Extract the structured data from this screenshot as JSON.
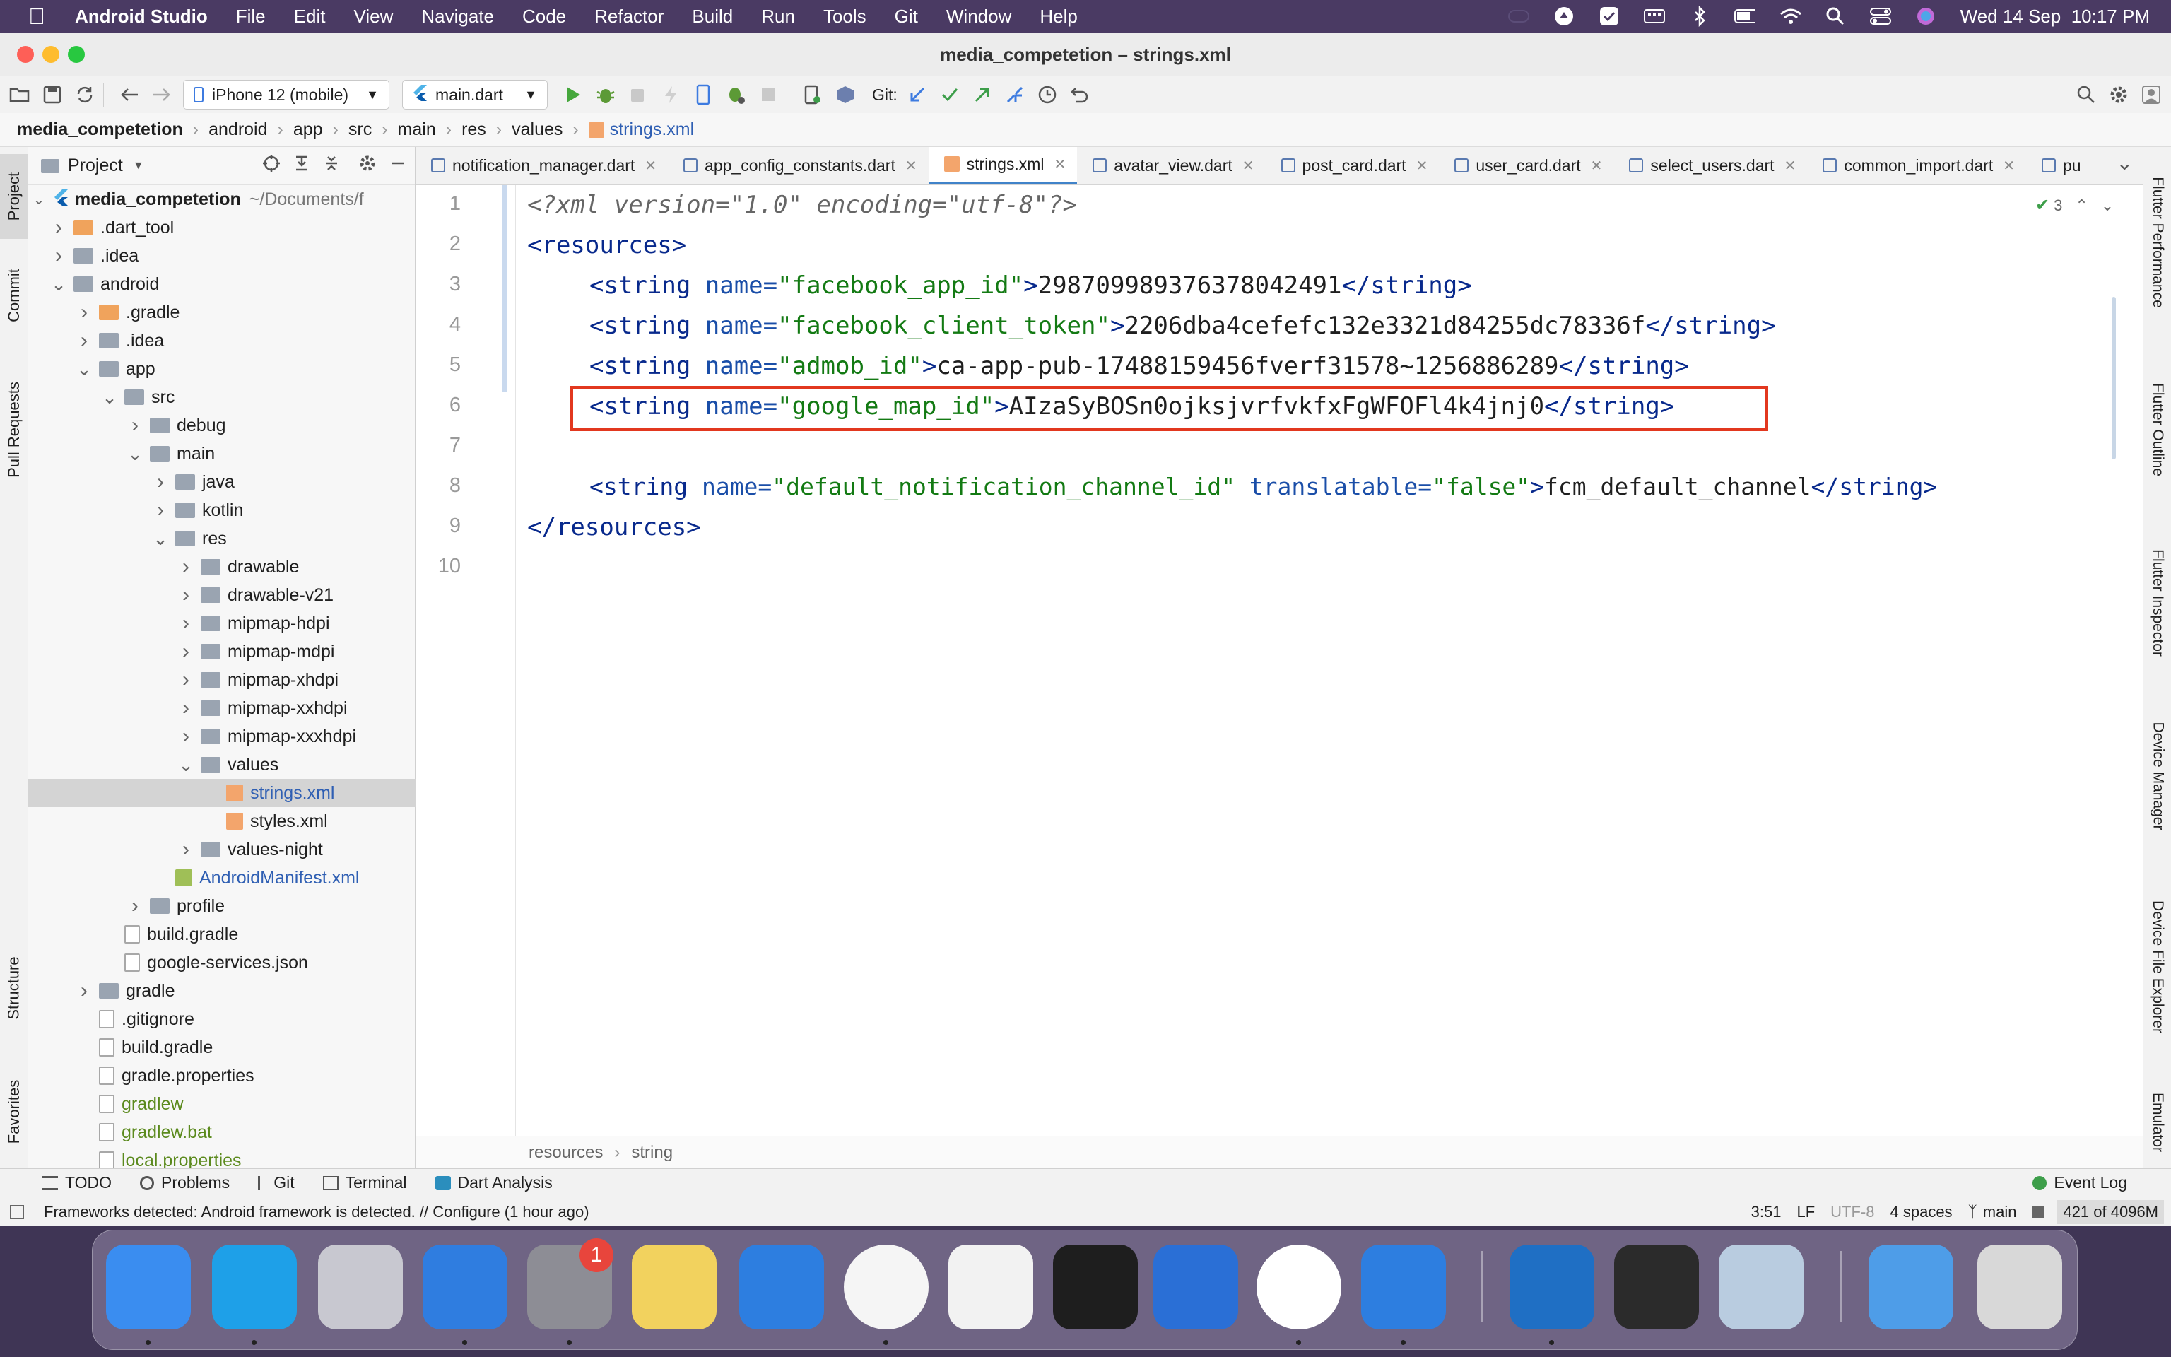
{
  "menubar": {
    "app_name": "Android Studio",
    "items": [
      "File",
      "Edit",
      "View",
      "Navigate",
      "Code",
      "Refactor",
      "Build",
      "Run",
      "Tools",
      "Git",
      "Window",
      "Help"
    ],
    "clock": "Wed 14 Sep  10:17 PM"
  },
  "window": {
    "title": "media_competetion – strings.xml"
  },
  "toolbar": {
    "device": "iPhone 12 (mobile)",
    "run_config": "main.dart",
    "git_label": "Git:"
  },
  "breadcrumb": [
    "media_competetion",
    "android",
    "app",
    "src",
    "main",
    "res",
    "values",
    "strings.xml"
  ],
  "side_tabs": {
    "left": [
      "Project",
      "Commit",
      "Pull Requests",
      "Structure",
      "Favorites"
    ],
    "right": [
      "Flutter Performance",
      "Flutter Outline",
      "Flutter Inspector",
      "Device Manager",
      "Device File Explorer",
      "Emulator"
    ]
  },
  "project_panel": {
    "header": "Project",
    "root_name": "media_competetion",
    "root_path": "~/Documents/f",
    "tree": [
      {
        "label": ".dart_tool",
        "depth": 1,
        "chev": "right",
        "kind": "folder-orange"
      },
      {
        "label": ".idea",
        "depth": 1,
        "chev": "right",
        "kind": "folder"
      },
      {
        "label": "android",
        "depth": 1,
        "chev": "down",
        "kind": "folder"
      },
      {
        "label": ".gradle",
        "depth": 2,
        "chev": "right",
        "kind": "folder-orange"
      },
      {
        "label": ".idea",
        "depth": 2,
        "chev": "right",
        "kind": "folder"
      },
      {
        "label": "app",
        "depth": 2,
        "chev": "down",
        "kind": "folder"
      },
      {
        "label": "src",
        "depth": 3,
        "chev": "down",
        "kind": "folder"
      },
      {
        "label": "debug",
        "depth": 4,
        "chev": "right",
        "kind": "folder"
      },
      {
        "label": "main",
        "depth": 4,
        "chev": "down",
        "kind": "folder"
      },
      {
        "label": "java",
        "depth": 5,
        "chev": "right",
        "kind": "folder"
      },
      {
        "label": "kotlin",
        "depth": 5,
        "chev": "right",
        "kind": "folder"
      },
      {
        "label": "res",
        "depth": 5,
        "chev": "down",
        "kind": "folder"
      },
      {
        "label": "drawable",
        "depth": 6,
        "chev": "right",
        "kind": "folder"
      },
      {
        "label": "drawable-v21",
        "depth": 6,
        "chev": "right",
        "kind": "folder"
      },
      {
        "label": "mipmap-hdpi",
        "depth": 6,
        "chev": "right",
        "kind": "folder"
      },
      {
        "label": "mipmap-mdpi",
        "depth": 6,
        "chev": "right",
        "kind": "folder"
      },
      {
        "label": "mipmap-xhdpi",
        "depth": 6,
        "chev": "right",
        "kind": "folder"
      },
      {
        "label": "mipmap-xxhdpi",
        "depth": 6,
        "chev": "right",
        "kind": "folder"
      },
      {
        "label": "mipmap-xxxhdpi",
        "depth": 6,
        "chev": "right",
        "kind": "folder"
      },
      {
        "label": "values",
        "depth": 6,
        "chev": "down",
        "kind": "folder"
      },
      {
        "label": "strings.xml",
        "depth": 7,
        "chev": "",
        "kind": "xml",
        "selected": true,
        "color": "#2f5fb3"
      },
      {
        "label": "styles.xml",
        "depth": 7,
        "chev": "",
        "kind": "xml"
      },
      {
        "label": "values-night",
        "depth": 6,
        "chev": "right",
        "kind": "folder"
      },
      {
        "label": "AndroidManifest.xml",
        "depth": 5,
        "chev": "",
        "kind": "manifest",
        "color": "#2f5fb3"
      },
      {
        "label": "profile",
        "depth": 4,
        "chev": "right",
        "kind": "folder"
      },
      {
        "label": "build.gradle",
        "depth": 3,
        "chev": "",
        "kind": "file"
      },
      {
        "label": "google-services.json",
        "depth": 3,
        "chev": "",
        "kind": "file"
      },
      {
        "label": "gradle",
        "depth": 2,
        "chev": "right",
        "kind": "folder"
      },
      {
        "label": ".gitignore",
        "depth": 2,
        "chev": "",
        "kind": "file"
      },
      {
        "label": "build.gradle",
        "depth": 2,
        "chev": "",
        "kind": "file"
      },
      {
        "label": "gradle.properties",
        "depth": 2,
        "chev": "",
        "kind": "file"
      },
      {
        "label": "gradlew",
        "depth": 2,
        "chev": "",
        "kind": "file",
        "color": "#5b8a1d"
      },
      {
        "label": "gradlew.bat",
        "depth": 2,
        "chev": "",
        "kind": "file",
        "color": "#5b8a1d"
      },
      {
        "label": "local.properties",
        "depth": 2,
        "chev": "",
        "kind": "file",
        "color": "#5b8a1d"
      }
    ]
  },
  "editor": {
    "tabs": [
      {
        "label": "notification_manager.dart",
        "active": false
      },
      {
        "label": "app_config_constants.dart",
        "active": false
      },
      {
        "label": "strings.xml",
        "active": true
      },
      {
        "label": "avatar_view.dart",
        "active": false
      },
      {
        "label": "post_card.dart",
        "active": false
      },
      {
        "label": "user_card.dart",
        "active": false
      },
      {
        "label": "select_users.dart",
        "active": false
      },
      {
        "label": "common_import.dart",
        "active": false
      },
      {
        "label": "pu",
        "active": false
      }
    ],
    "line_numbers": [
      "1",
      "2",
      "3",
      "4",
      "5",
      "6",
      "7",
      "8",
      "9",
      "10"
    ],
    "inspection_count": "3",
    "code": {
      "l1": "<?xml version=\"1.0\" encoding=\"utf-8\"?>",
      "l2": "<resources>",
      "l3": {
        "name": "\"facebook_app_id\"",
        "value": "298709989376378042491"
      },
      "l4": {
        "name": "\"facebook_client_token\"",
        "value": "2206dba4cefefc132e3321d84255dc78336f"
      },
      "l5": {
        "name": "\"admob_id\"",
        "value": "ca-app-pub-17488159456fverf31578~1256886289"
      },
      "l6": {
        "name": "\"google_map_id\"",
        "value": "AIzaSyBOSn0ojksjvrfvkfxFgWFOFl4k4jnj0"
      },
      "l8": {
        "name": "\"default_notification_channel_id\"",
        "attr2": "translatable=",
        "attr2val": "\"false\"",
        "value": "fcm_default_channel"
      },
      "l9": "</resources>"
    },
    "status_path": [
      "resources",
      "string"
    ]
  },
  "bottom_tools": [
    "TODO",
    "Problems",
    "Git",
    "Terminal",
    "Dart Analysis"
  ],
  "event_log": "Event Log",
  "status_bar": {
    "message": "Frameworks detected: Android framework is detected. // Configure (1 hour ago)",
    "position": "3:51",
    "line_sep": "LF",
    "encoding": "UTF-8",
    "indent": "4 spaces",
    "branch": "main",
    "memory": "421 of 4096M"
  },
  "dock": {
    "badge": "1",
    "apps": [
      "Finder",
      "Skype",
      "Launchpad",
      "Safari",
      "System Preferences",
      "Notes",
      "Xcode",
      "Chrome",
      "TextEdit",
      "Figma",
      "Proxyman",
      "Android Studio",
      "Simulator",
      "VS Code",
      "QuickTime",
      "Preview",
      "Folder",
      "Trash"
    ]
  },
  "colors": {
    "highlight_box": "#e2381f",
    "menubar": "#4a3a63",
    "selection": "#d4d4d4"
  }
}
